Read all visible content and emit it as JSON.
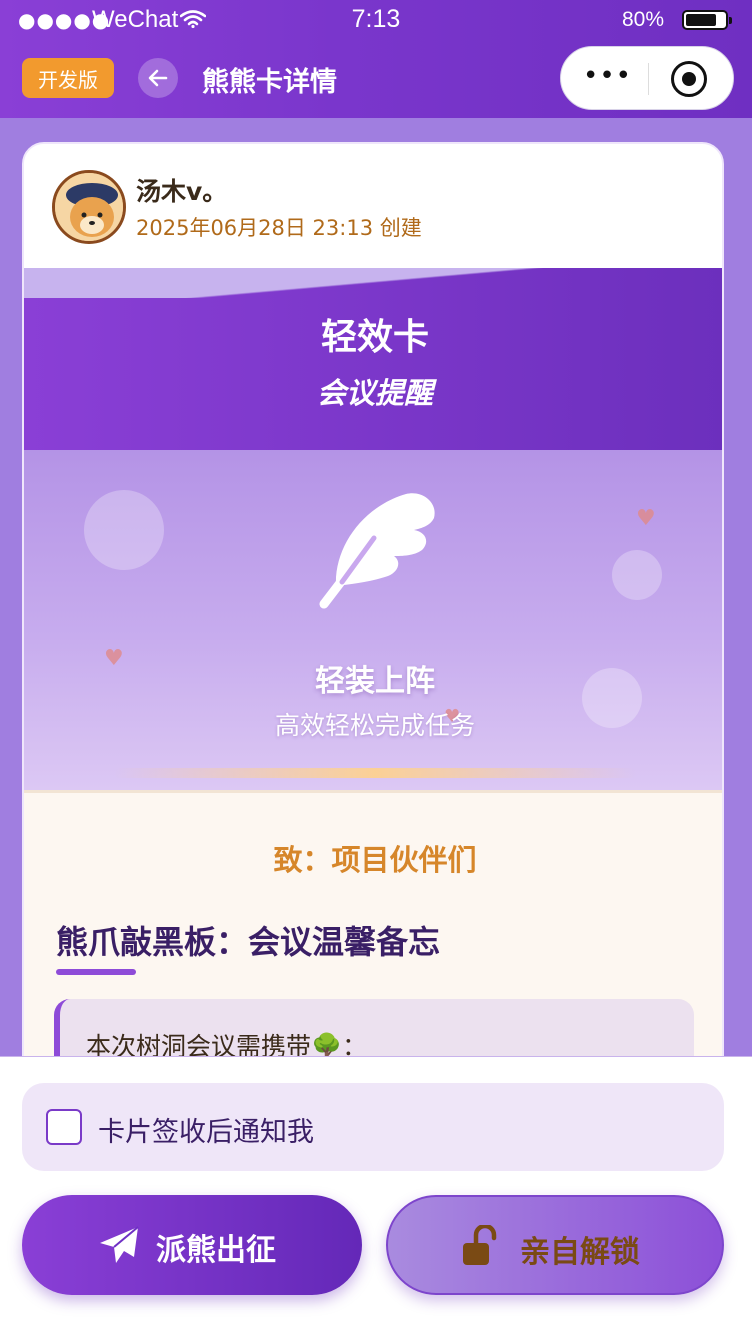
{
  "status_bar": {
    "signal": "●●●●●",
    "carrier": "WeChat",
    "time": "7:13",
    "battery_percent": "80%",
    "battery_level": 0.8
  },
  "nav": {
    "dev_badge": "开发版",
    "title": "熊熊卡详情",
    "capsule_more": "•••"
  },
  "card": {
    "author_name": "汤木v。",
    "created": "2025年06月28日 23:13 创建",
    "banner_title": "轻效卡",
    "banner_subtitle": "会议提醒",
    "hero_title": "轻装上阵",
    "hero_subtitle": "高效轻松完成任务",
    "greeting": "致：项目伙伴们",
    "content_title": "熊爪敲黑板：会议温馨备忘",
    "note_text": "本次树洞会议需携带🌳："
  },
  "bottom": {
    "notify_label": "卡片签收后通知我",
    "notify_checked": false,
    "send_button": "派熊出征",
    "unlock_button": "亲自解锁"
  },
  "colors": {
    "accent": "#8a3fd6",
    "accent_dark": "#6428b8",
    "dev_badge": "#f29a2e",
    "greeting": "#d6862a",
    "title_text": "#3a1f66"
  },
  "icons": {
    "back": "arrow-left-icon",
    "capsule_close": "target-icon",
    "hero": "feather-icon",
    "send": "paper-plane-icon",
    "unlock": "unlock-icon",
    "note_emoji": "tree-icon"
  }
}
